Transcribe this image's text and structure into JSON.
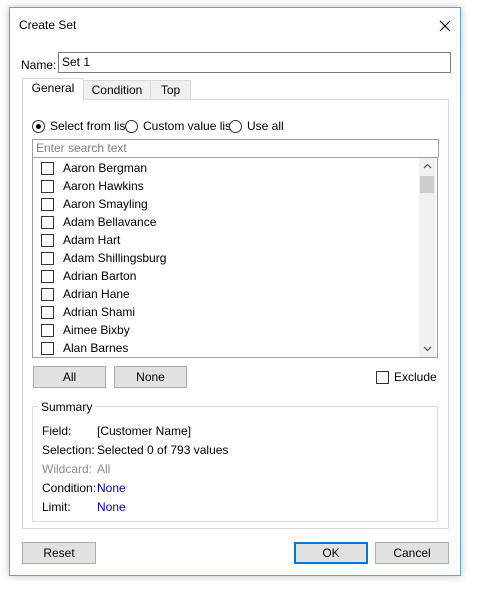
{
  "dialog": {
    "title": "Create Set",
    "name_label": "Name:",
    "name_value": "Set 1"
  },
  "tabs": [
    {
      "label": "General",
      "active": true
    },
    {
      "label": "Condition",
      "active": false
    },
    {
      "label": "Top",
      "active": false
    }
  ],
  "selection_mode": {
    "options": [
      "Select from list",
      "Custom value list",
      "Use all"
    ],
    "selected": "Select from list"
  },
  "search": {
    "placeholder": "Enter search text"
  },
  "list": {
    "items": [
      {
        "label": "Aaron Bergman",
        "checked": false
      },
      {
        "label": "Aaron Hawkins",
        "checked": false
      },
      {
        "label": "Aaron Smayling",
        "checked": false
      },
      {
        "label": "Adam Bellavance",
        "checked": false
      },
      {
        "label": "Adam Hart",
        "checked": false
      },
      {
        "label": "Adam Shillingsburg",
        "checked": false
      },
      {
        "label": "Adrian Barton",
        "checked": false
      },
      {
        "label": "Adrian Hane",
        "checked": false
      },
      {
        "label": "Adrian Shami",
        "checked": false
      },
      {
        "label": "Aimee Bixby",
        "checked": false
      },
      {
        "label": "Alan Barnes",
        "checked": false
      }
    ]
  },
  "list_buttons": {
    "all": "All",
    "none": "None"
  },
  "exclude": {
    "label": "Exclude",
    "checked": false
  },
  "summary": {
    "title": "Summary",
    "rows": [
      {
        "label": "Field:",
        "value": "[Customer Name]"
      },
      {
        "label": "Selection:",
        "value": "Selected 0 of 793 values"
      },
      {
        "label": "Wildcard:",
        "value": "All"
      },
      {
        "label": "Condition:",
        "value": "None"
      },
      {
        "label": "Limit:",
        "value": "None"
      }
    ]
  },
  "footer": {
    "reset": "Reset",
    "ok": "OK",
    "cancel": "Cancel"
  },
  "colors": {
    "accent": "#0078d7",
    "link": "#0000cc",
    "disabled": "#8a8a8a"
  },
  "icons": {
    "close": "close-icon",
    "scroll_up": "chevron-up-icon",
    "scroll_down": "chevron-down-icon"
  }
}
